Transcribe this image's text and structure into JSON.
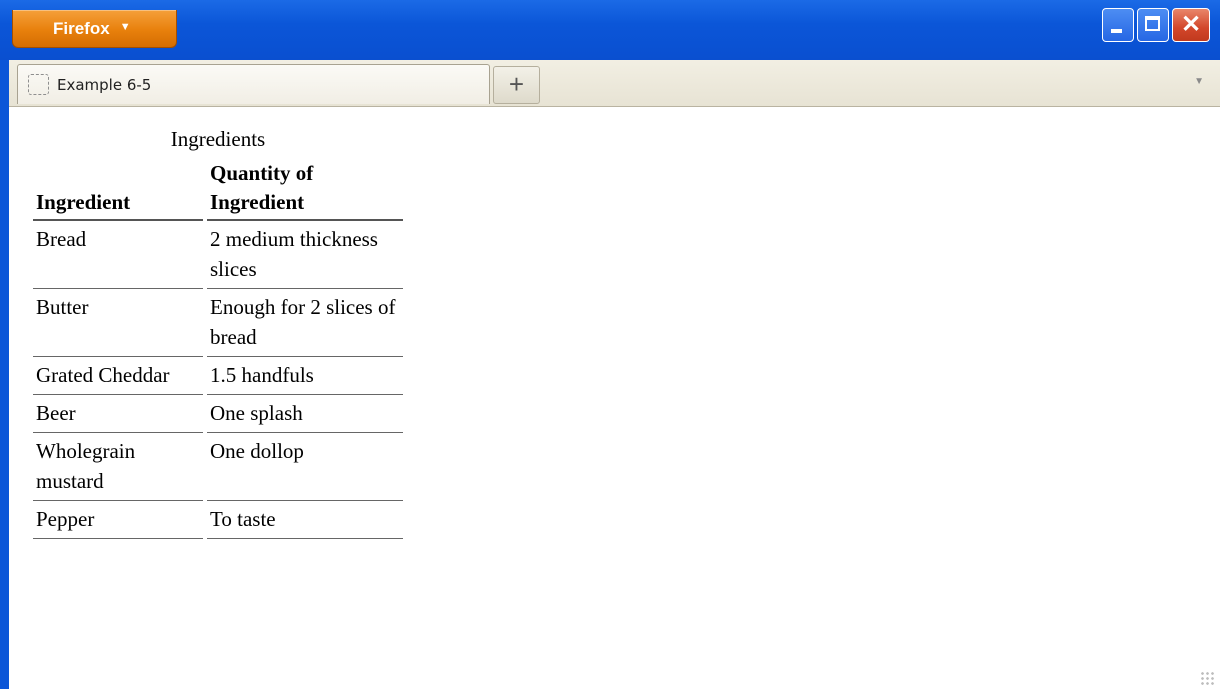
{
  "window": {
    "app_menu_label": "Firefox",
    "title_bar_color": "#0b56d8",
    "app_button_color": "#e8800c",
    "close_button_color": "#d2462a",
    "controls": {
      "minimize": "minimize-icon",
      "maximize": "maximize-icon",
      "close": "close-icon"
    }
  },
  "tabs": [
    {
      "label": "Example 6-5",
      "icon": "page-placeholder-icon",
      "active": true
    }
  ],
  "new_tab_label": "+",
  "table": {
    "caption": "Ingredients",
    "headers": [
      "Ingredient",
      "Quantity of Ingredient"
    ],
    "rows": [
      [
        "Bread",
        "2 medium thickness slices"
      ],
      [
        "Butter",
        "Enough for 2 slices of bread"
      ],
      [
        "Grated Cheddar",
        "1.5 handfuls"
      ],
      [
        "Beer",
        "One splash"
      ],
      [
        "Wholegrain mustard",
        "One dollop"
      ],
      [
        "Pepper",
        "To taste"
      ]
    ]
  }
}
